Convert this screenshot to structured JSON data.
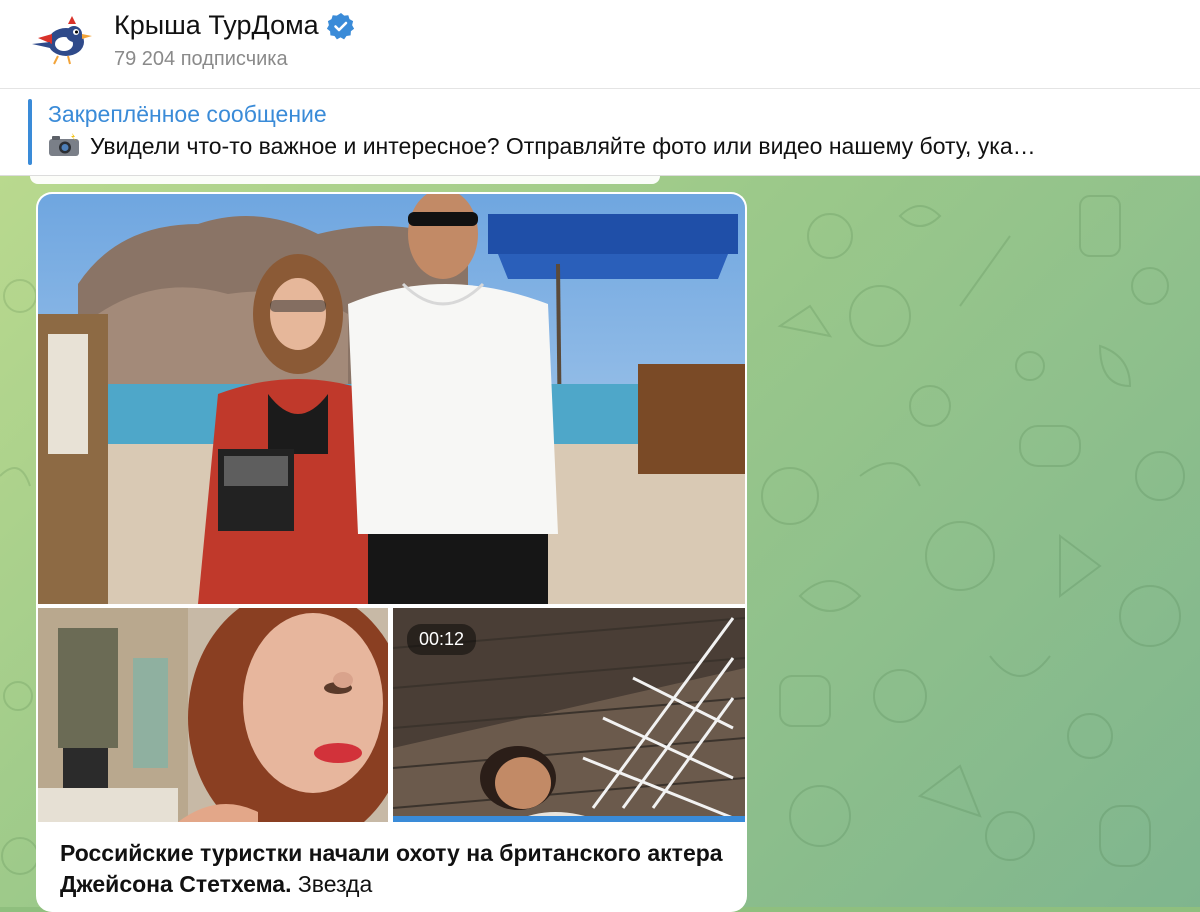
{
  "channel": {
    "title": "Крыша ТурДома",
    "subscribers": "79 204 подписчика",
    "verified": true
  },
  "pinned": {
    "label": "Закреплённое сообщение",
    "icon": "camera-with-flash-icon",
    "text": "Увидели что-то важное и интересное?   Отправляйте фото или видео нашему боту, ука…"
  },
  "post": {
    "media": {
      "video_duration": "00:12"
    },
    "headline": "Российские туристки начали охоту на британского актера Джейсона Стетхема.",
    "body": " Звезда"
  },
  "colors": {
    "accent": "#3a8bd8",
    "chat_bg": "#9cc98a"
  }
}
